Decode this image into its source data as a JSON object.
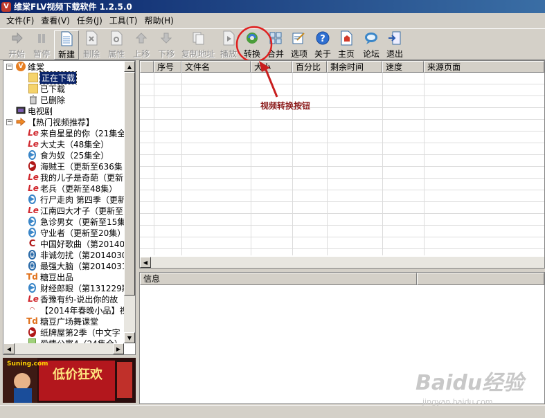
{
  "window": {
    "title": "维棠FLV视频下载软件 1.2.5.0",
    "icon": "V"
  },
  "menu": [
    {
      "label": "文件(F)"
    },
    {
      "label": "查看(V)"
    },
    {
      "label": "任务(J)"
    },
    {
      "label": "工具(T)"
    },
    {
      "label": "帮助(H)"
    }
  ],
  "toolbar": [
    {
      "label": "开始",
      "icon": "start-icon",
      "enabled": false
    },
    {
      "label": "暂停",
      "icon": "pause-icon",
      "enabled": false
    },
    {
      "label": "新建",
      "icon": "new-icon",
      "enabled": true,
      "active": true
    },
    {
      "label": "删除",
      "icon": "delete-icon",
      "enabled": false
    },
    {
      "label": "属性",
      "icon": "properties-icon",
      "enabled": false
    },
    {
      "label": "上移",
      "icon": "move-up-icon",
      "enabled": false
    },
    {
      "label": "下移",
      "icon": "move-down-icon",
      "enabled": false
    },
    {
      "label": "复制地址",
      "icon": "copy-address-icon",
      "enabled": false
    },
    {
      "label": "播放",
      "icon": "play-icon",
      "enabled": false
    },
    {
      "label": "转换",
      "icon": "convert-icon",
      "enabled": true
    },
    {
      "label": "合并",
      "icon": "merge-icon",
      "enabled": true
    },
    {
      "label": "选项",
      "icon": "options-icon",
      "enabled": true
    },
    {
      "label": "关于",
      "icon": "about-icon",
      "enabled": true
    },
    {
      "label": "主页",
      "icon": "homepage-icon",
      "enabled": true
    },
    {
      "label": "论坛",
      "icon": "forum-icon",
      "enabled": true
    },
    {
      "label": "退出",
      "icon": "exit-icon",
      "enabled": true
    }
  ],
  "tree": {
    "root": "维棠",
    "children": [
      "正在下载",
      "已下载",
      "已删除"
    ],
    "tv": "电视剧",
    "hot": "【热门视频推荐】",
    "hot_items": [
      {
        "text": "来自星星的你（21集全",
        "icon": "le"
      },
      {
        "text": "大丈夫（48集全）",
        "icon": "le"
      },
      {
        "text": "食为奴（25集全）",
        "icon": "play"
      },
      {
        "text": "海贼王（更新至636集",
        "icon": "onepiece"
      },
      {
        "text": "我的儿子是奇葩（更新",
        "icon": "le"
      },
      {
        "text": "老兵（更新至48集）",
        "icon": "le"
      },
      {
        "text": "行尸走肉 第四季（更新",
        "icon": "play"
      },
      {
        "text": "江南四大才子（更新至",
        "icon": "le"
      },
      {
        "text": "急诊男女（更新至15集",
        "icon": "play"
      },
      {
        "text": "守业者（更新至20集）",
        "icon": "play"
      },
      {
        "text": "中国好歌曲（第20140",
        "icon": "c"
      },
      {
        "text": "非诚勿扰（第2014030",
        "icon": "film"
      },
      {
        "text": "最强大脑（第2014031",
        "icon": "film"
      },
      {
        "text": "糖豆出品",
        "icon": "td"
      },
      {
        "text": "财经郎眼（第131229期",
        "icon": "play"
      },
      {
        "text": "香豫有约-说出你的故",
        "icon": "le"
      },
      {
        "text": "【2014年春晚小品】视",
        "icon": "cctv"
      },
      {
        "text": "糖豆广场舞课堂",
        "icon": "td"
      },
      {
        "text": "纸牌屋第2季（中文字",
        "icon": "onepiece"
      },
      {
        "text": "爱情公寓4（24集全）",
        "icon": "tv"
      }
    ]
  },
  "ad": {
    "site": "Suning.com",
    "slogan": "低价狂欢"
  },
  "grid": {
    "columns": [
      "序号",
      "文件名",
      "大小",
      "百分比",
      "剩余时间",
      "速度",
      "来源页面"
    ],
    "rows": []
  },
  "info": {
    "columns": [
      "信息",
      ""
    ]
  },
  "annotation": {
    "text": "视频转换按钮"
  },
  "watermark": {
    "brand": "Baidu经验",
    "url": "jingyan.baidu.com"
  },
  "colors": {
    "highlight": "#e02020",
    "annotation": "#8b1a1a",
    "selection": "#0a246a"
  }
}
